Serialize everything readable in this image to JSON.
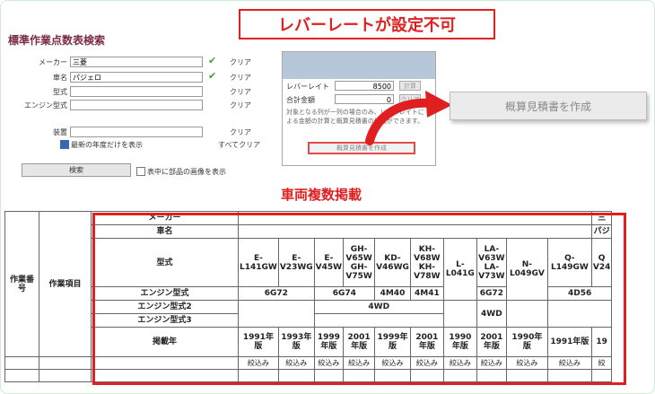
{
  "callout_top": "レバーレートが設定不可",
  "app_title": "標準作業点数表検索",
  "search": {
    "fields": [
      {
        "label": "メーカー",
        "value": "三菱",
        "checked": true,
        "clear": "クリア"
      },
      {
        "label": "車名",
        "value": "パジェロ",
        "checked": true,
        "clear": "クリア"
      },
      {
        "label": "型式",
        "value": "",
        "checked": false,
        "clear": "クリア"
      },
      {
        "label": "エンジン型式",
        "value": "",
        "checked": false,
        "clear": "クリア"
      },
      {
        "label": "装置",
        "value": "",
        "checked": false,
        "clear": "クリア"
      }
    ],
    "latest_year_label": "最新の年度だけを表示",
    "clear_all": "すべてクリア",
    "search_button": "検索",
    "show_images_label": "表中に部品の画像を表示"
  },
  "lever_panel": {
    "lever_rate_label": "レバーレイト",
    "lever_rate_value": "8500",
    "calc_button": "計算",
    "total_label": "合計金額",
    "total_value": "0",
    "clear_button": "クリア",
    "note": "対象となる列が一列の場合のみ、レバーレイトによる金額の計算と概算見積書の作成ができます。",
    "estimate_button": "概算見積書を作成"
  },
  "big_estimate_button": "概算見積書を作成",
  "caption_multi": "車両複数掲載",
  "table": {
    "col_no": "作業番号",
    "col_item": "作業項目",
    "row_labels": {
      "maker": "メーカー",
      "car": "車名",
      "model": "型式",
      "engine": "エンジン型式",
      "engine2": "エンジン型式2",
      "engine3": "エンジン型式3",
      "year": "掲載年"
    },
    "maker_partial": "三",
    "car_partial": "パジ",
    "models": [
      "E-L141GW",
      "E-V23WG",
      "E-V45W",
      "GH-V65W GH-V75W",
      "KD-V46WG",
      "KH-V68W KH-V78W",
      "L-L041G",
      "LA-V63W LA-V73W",
      "N-L049GV",
      "Q-L149GW",
      "Q V24"
    ],
    "engines": [
      "6G72",
      "6G74",
      "4M40",
      "4M41",
      "6G72",
      "4D56"
    ],
    "drive": "4WD",
    "drive2": "4WD",
    "years": [
      "1991年版",
      "1993年版",
      "1999年版",
      "2001年版",
      "1999年版",
      "2001年版",
      "1990年版",
      "2001年版",
      "1990年版",
      "1991年版",
      "19"
    ],
    "filter": "絞込み",
    "filter_partial": "絞"
  }
}
